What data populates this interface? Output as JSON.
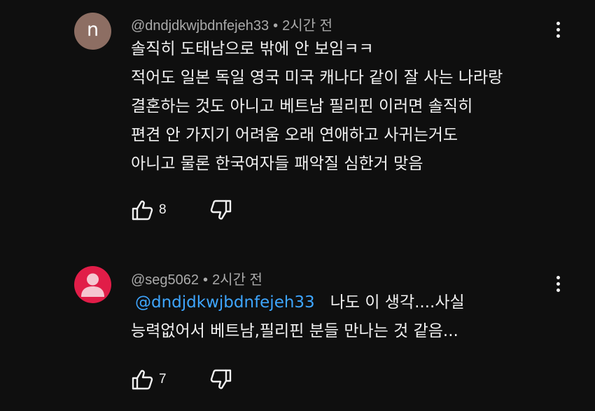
{
  "comments": [
    {
      "avatar_letter": "n",
      "avatar_color": "#8d6e63",
      "username": "@dndjdkwjbdnfejeh33",
      "separator": "•",
      "time": "2시간 전",
      "lines": [
        "솔직히 도태남으로 밖에 안 보임ㅋㅋ",
        "적어도 일본 독일 영국 미국 캐나다 같이 잘 사는 나라랑",
        "결혼하는 것도 아니고 베트남 필리핀 이러면 솔직히",
        "편견 안 가지기 어려움 오래 연애하고 사귀는거도",
        "아니고 물론 한국여자들 패악질 심한거 맞음"
      ],
      "likes": "8",
      "like_icon": "thumb-up-icon",
      "dislike_icon": "thumb-down-icon",
      "menu_icon": "more-vertical-icon"
    },
    {
      "avatar_color": "#e11d48",
      "avatar_icon": "person-icon",
      "username": "@seg5062",
      "separator": "•",
      "time": "2시간 전",
      "mention": "@dndjdkwjbdnfejeh33",
      "lines": [
        "나도 이 생각....사실",
        "능력없어서 베트남,필리핀 분들 만나는 것 같음..."
      ],
      "likes": "7",
      "like_icon": "thumb-up-icon",
      "dislike_icon": "thumb-down-icon",
      "menu_icon": "more-vertical-icon"
    }
  ],
  "colors": {
    "background": "#0f0f0f",
    "text": "#f1f1f1",
    "secondary_text": "#aaaaaa",
    "mention": "#3ea6ff"
  }
}
